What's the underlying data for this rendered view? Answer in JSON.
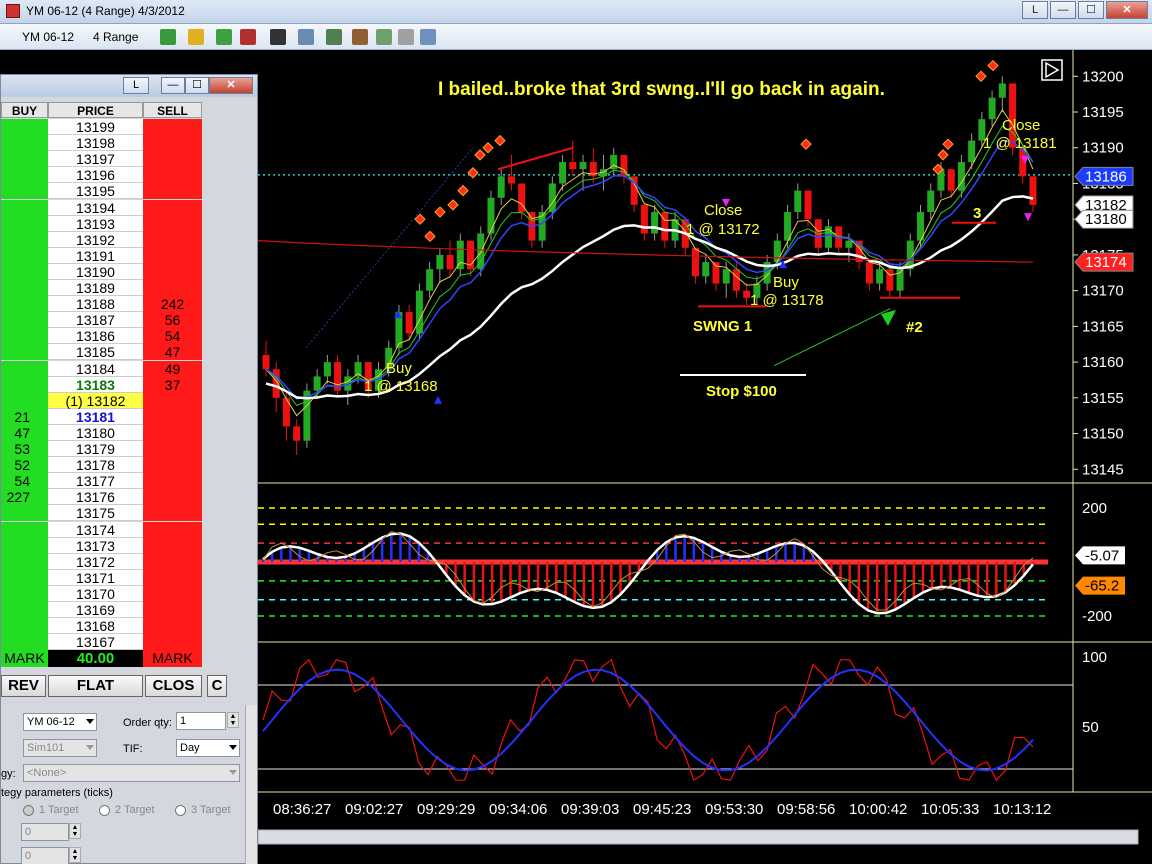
{
  "window": {
    "title": "YM 06-12 (4 Range)  4/3/2012",
    "buttons": {
      "link": "L",
      "minimize": "—",
      "maximize": "☐",
      "close": "✕"
    }
  },
  "toolbar": {
    "instrument": "YM 06-12",
    "period": "4 Range",
    "icons": [
      "bar-type-icon",
      "pencil-icon",
      "zoom-in-icon",
      "zoom-out-icon",
      "crosshair-icon",
      "magnify-icon",
      "indicators-icon",
      "strategy-icon",
      "data-box-icon",
      "properties-icon"
    ]
  },
  "dom": {
    "titlebar": {
      "link": "L",
      "minimize": "—",
      "maximize": "☐",
      "close": "✕"
    },
    "headers": {
      "buy": "BUY",
      "price": "PRICE",
      "sell": "SELL"
    },
    "rows": [
      {
        "price": "13199",
        "buy": "",
        "sell": ""
      },
      {
        "price": "13198",
        "buy": "",
        "sell": ""
      },
      {
        "price": "13197",
        "buy": "",
        "sell": ""
      },
      {
        "price": "13196",
        "buy": "",
        "sell": ""
      },
      {
        "price": "13195",
        "buy": "",
        "sell": ""
      },
      {
        "price": "13194",
        "buy": "",
        "sell": ""
      },
      {
        "price": "13193",
        "buy": "",
        "sell": ""
      },
      {
        "price": "13192",
        "buy": "",
        "sell": ""
      },
      {
        "price": "13191",
        "buy": "",
        "sell": ""
      },
      {
        "price": "13190",
        "buy": "",
        "sell": ""
      },
      {
        "price": "13189",
        "buy": "",
        "sell": ""
      },
      {
        "price": "13188",
        "buy": "",
        "sell": "242"
      },
      {
        "price": "13187",
        "buy": "",
        "sell": "56"
      },
      {
        "price": "13186",
        "buy": "",
        "sell": "54"
      },
      {
        "price": "13185",
        "buy": "",
        "sell": "47"
      },
      {
        "price": "13184",
        "buy": "",
        "sell": "49"
      },
      {
        "price": "13183",
        "buy": "",
        "sell": "37",
        "kind": "ask"
      },
      {
        "price": "(1) 13182",
        "buy": "",
        "sell": "",
        "kind": "pos"
      },
      {
        "price": "13181",
        "buy": "21",
        "sell": "",
        "kind": "bid"
      },
      {
        "price": "13180",
        "buy": "47",
        "sell": ""
      },
      {
        "price": "13179",
        "buy": "53",
        "sell": ""
      },
      {
        "price": "13178",
        "buy": "52",
        "sell": ""
      },
      {
        "price": "13177",
        "buy": "54",
        "sell": ""
      },
      {
        "price": "13176",
        "buy": "227",
        "sell": ""
      },
      {
        "price": "13175",
        "buy": "",
        "sell": ""
      },
      {
        "price": "13174",
        "buy": "",
        "sell": ""
      },
      {
        "price": "13173",
        "buy": "",
        "sell": ""
      },
      {
        "price": "13172",
        "buy": "",
        "sell": ""
      },
      {
        "price": "13171",
        "buy": "",
        "sell": ""
      },
      {
        "price": "13170",
        "buy": "",
        "sell": ""
      },
      {
        "price": "13169",
        "buy": "",
        "sell": ""
      },
      {
        "price": "13168",
        "buy": "",
        "sell": ""
      },
      {
        "price": "13167",
        "buy": "",
        "sell": ""
      }
    ],
    "mark_left": "MARK",
    "pnl": "40.00",
    "mark_right": "MARK",
    "buttons": {
      "rev": "REV",
      "flat": "FLAT",
      "close": "CLOS",
      "c": "C"
    },
    "instrument_value": "YM 06-12",
    "order_qty_label": "Order qty:",
    "order_qty_value": "1",
    "account_value": "Sim101",
    "tif_label": "TIF:",
    "tif_value": "Day",
    "strategy_label": "gy:",
    "strategy_value": "<None>",
    "params_label": "tegy parameters (ticks)",
    "target1": "1 Target",
    "target2": "2 Target",
    "target3": "3 Target",
    "param1": "0",
    "param2": "0"
  },
  "chart_data": {
    "type": "candlestick",
    "price_axis": {
      "ticks": [
        "13200",
        "13195",
        "13190",
        "13185",
        "13180",
        "13175",
        "13170",
        "13165",
        "13160",
        "13155",
        "13150",
        "13145"
      ],
      "range": [
        13143.5,
        13202
      ]
    },
    "time_labels": [
      "08:36:27",
      "09:02:27",
      "09:29:29",
      "09:34:06",
      "09:39:03",
      "09:45:23",
      "09:53:30",
      "09:58:56",
      "10:00:42",
      "10:05:33",
      "10:13:12"
    ],
    "price_markers": [
      {
        "value": "13186",
        "color": "#1a3cff"
      },
      {
        "value": "13182",
        "color": "#ffffff"
      },
      {
        "value": "13180",
        "color": "#ffffff"
      },
      {
        "value": "13174",
        "color": "#ff2020"
      }
    ],
    "candles": [
      [
        13161,
        13163,
        13158,
        13159
      ],
      [
        13159,
        13160,
        13153,
        13155
      ],
      [
        13155,
        13156,
        13149,
        13151
      ],
      [
        13151,
        13152,
        13147,
        13149
      ],
      [
        13149,
        13157,
        13148,
        13156
      ],
      [
        13156,
        13159,
        13155,
        13158
      ],
      [
        13158,
        13161,
        13157,
        13160
      ],
      [
        13160,
        13161,
        13155,
        13156
      ],
      [
        13156,
        13159,
        13154,
        13158
      ],
      [
        13158,
        13161,
        13157,
        13160
      ],
      [
        13160,
        13159,
        13155,
        13156
      ],
      [
        13156,
        13160,
        13155,
        13159
      ],
      [
        13159,
        13163,
        13158,
        13162
      ],
      [
        13162,
        13168,
        13161,
        13167
      ],
      [
        13167,
        13168,
        13163,
        13164
      ],
      [
        13164,
        13171,
        13163,
        13170
      ],
      [
        13170,
        13174,
        13169,
        13173
      ],
      [
        13173,
        13176,
        13171,
        13175
      ],
      [
        13175,
        13177,
        13172,
        13173
      ],
      [
        13173,
        13178,
        13172,
        13177
      ],
      [
        13177,
        13176,
        13172,
        13173
      ],
      [
        13173,
        13179,
        13172,
        13178
      ],
      [
        13178,
        13184,
        13177,
        13183
      ],
      [
        13183,
        13187,
        13182,
        13186
      ],
      [
        13186,
        13189,
        13184,
        13185
      ],
      [
        13185,
        13184,
        13180,
        13181
      ],
      [
        13181,
        13180,
        13176,
        13177
      ],
      [
        13177,
        13182,
        13176,
        13181
      ],
      [
        13181,
        13186,
        13180,
        13185
      ],
      [
        13185,
        13189,
        13184,
        13188
      ],
      [
        13188,
        13191,
        13186,
        13187
      ],
      [
        13187,
        13189,
        13184,
        13188
      ],
      [
        13188,
        13190,
        13185,
        13186
      ],
      [
        13186,
        13189,
        13184,
        13187
      ],
      [
        13187,
        13190,
        13186,
        13189
      ],
      [
        13189,
        13188,
        13185,
        13186
      ],
      [
        13186,
        13185,
        13181,
        13182
      ],
      [
        13182,
        13181,
        13177,
        13178
      ],
      [
        13178,
        13182,
        13177,
        13181
      ],
      [
        13181,
        13180,
        13176,
        13177
      ],
      [
        13177,
        13181,
        13176,
        13180
      ],
      [
        13180,
        13179,
        13175,
        13176
      ],
      [
        13176,
        13175,
        13171,
        13172
      ],
      [
        13172,
        13175,
        13171,
        13174
      ],
      [
        13174,
        13173,
        13170,
        13171
      ],
      [
        13171,
        13174,
        13169,
        13173
      ],
      [
        13173,
        13174,
        13169,
        13170
      ],
      [
        13170,
        13171,
        13168,
        13169
      ],
      [
        13169,
        13172,
        13168,
        13171
      ],
      [
        13171,
        13175,
        13170,
        13174
      ],
      [
        13174,
        13178,
        13173,
        13177
      ],
      [
        13177,
        13182,
        13176,
        13181
      ],
      [
        13181,
        13185,
        13180,
        13184
      ],
      [
        13184,
        13183,
        13179,
        13180
      ],
      [
        13180,
        13179,
        13175,
        13176
      ],
      [
        13176,
        13180,
        13175,
        13179
      ],
      [
        13179,
        13178,
        13175,
        13176
      ],
      [
        13176,
        13178,
        13174,
        13177
      ],
      [
        13177,
        13176,
        13173,
        13174
      ],
      [
        13174,
        13173,
        13170,
        13171
      ],
      [
        13171,
        13174,
        13170,
        13173
      ],
      [
        13173,
        13172,
        13169,
        13170
      ],
      [
        13170,
        13174,
        13169,
        13173
      ],
      [
        13173,
        13178,
        13172,
        13177
      ],
      [
        13177,
        13182,
        13176,
        13181
      ],
      [
        13181,
        13185,
        13180,
        13184
      ],
      [
        13184,
        13188,
        13183,
        13187
      ],
      [
        13187,
        13186,
        13183,
        13184
      ],
      [
        13184,
        13189,
        13183,
        13188
      ],
      [
        13188,
        13192,
        13187,
        13191
      ],
      [
        13191,
        13195,
        13190,
        13194
      ],
      [
        13194,
        13198,
        13193,
        13197
      ],
      [
        13197,
        13200,
        13195,
        13199
      ],
      [
        13199,
        13198,
        13189,
        13190
      ],
      [
        13190,
        13189,
        13185,
        13186
      ],
      [
        13186,
        13185,
        13181,
        13182
      ]
    ],
    "annotations": {
      "headline": "I bailed..broke that 3rd swng..I'll go back in again.",
      "buy1_a": "Buy",
      "buy1_b": "1 @ 13168",
      "close1_a": "Close",
      "close1_b": "1 @ 13172",
      "buy2_a": "Buy",
      "buy2_b": "1 @ 13178",
      "close2_a": "Close",
      "close2_b": "1 @ 13181",
      "swing1": "SWNG 1",
      "stop": "Stop $100",
      "swing2": "#2",
      "swing3": "3"
    },
    "osc1_ticks": [
      "200",
      "-200"
    ],
    "osc1_markers": [
      "-5.07",
      "-65.2"
    ],
    "osc2_ticks": [
      "100",
      "50"
    ],
    "colors": {
      "up": "#22aa22",
      "down": "#ee1111",
      "ema_white": "#ffffff",
      "ema_red": "#cc1111",
      "annotation": "#ffff33"
    }
  }
}
